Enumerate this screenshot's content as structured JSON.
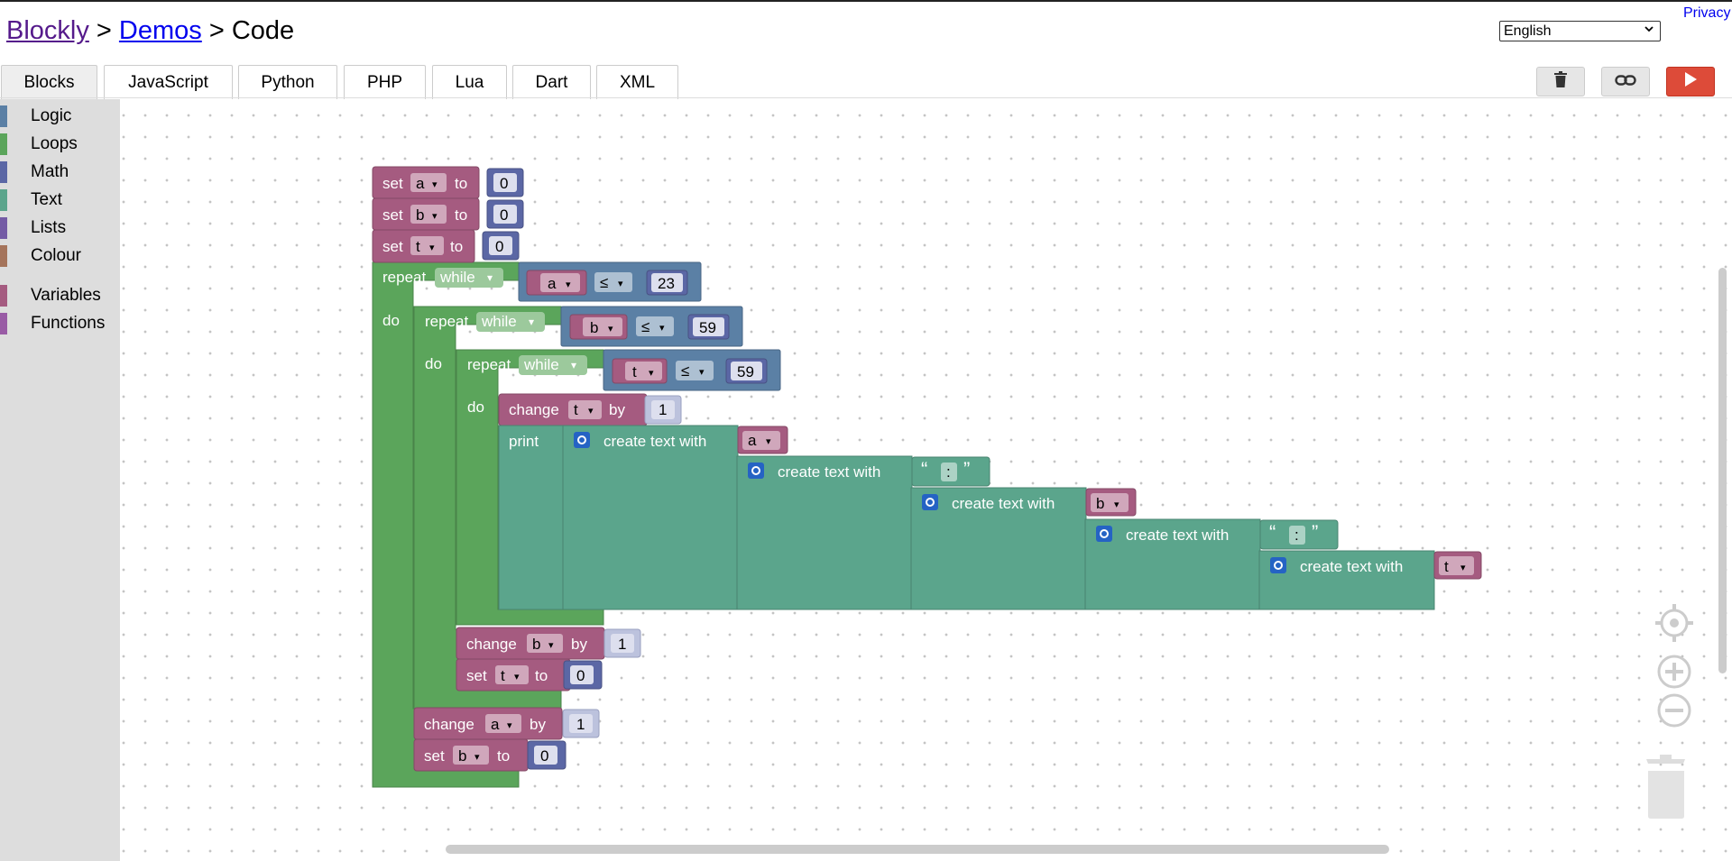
{
  "breadcrumb": {
    "root": "Blockly",
    "sep1": ">",
    "demos": "Demos",
    "sep2": ">",
    "current": "Code"
  },
  "privacy_link": "Privacy",
  "language_select": {
    "selected": "English"
  },
  "tabs": [
    {
      "label": "Blocks",
      "active": true
    },
    {
      "label": "JavaScript",
      "active": false
    },
    {
      "label": "Python",
      "active": false
    },
    {
      "label": "PHP",
      "active": false
    },
    {
      "label": "Lua",
      "active": false
    },
    {
      "label": "Dart",
      "active": false
    },
    {
      "label": "XML",
      "active": false
    }
  ],
  "toolbar_icons": {
    "trash": "trash-icon",
    "link": "link-icon",
    "run": "play-icon"
  },
  "toolbox": {
    "categories": [
      {
        "label": "Logic",
        "color": "#5b80a5"
      },
      {
        "label": "Loops",
        "color": "#5ba55b"
      },
      {
        "label": "Math",
        "color": "#5b67a5"
      },
      {
        "label": "Text",
        "color": "#5ba58c"
      },
      {
        "label": "Lists",
        "color": "#745ba5"
      },
      {
        "label": "Colour",
        "color": "#a5745b"
      },
      {
        "label": "Variables",
        "color": "#a55b80"
      },
      {
        "label": "Functions",
        "color": "#995ba5"
      }
    ]
  },
  "colors": {
    "variables": "#a55b80",
    "loops": "#5ba55b",
    "math": "#5b67a5",
    "logic": "#5b80a5",
    "text": "#5ba58c",
    "run": "#dd4b39"
  },
  "blocks": {
    "set_a": {
      "set": "set",
      "var": "a",
      "to": "to",
      "value": "0"
    },
    "set_b": {
      "set": "set",
      "var": "b",
      "to": "to",
      "value": "0"
    },
    "set_t": {
      "set": "set",
      "var": "t",
      "to": "to",
      "value": "0"
    },
    "loop1": {
      "repeat": "repeat",
      "mode": "while",
      "var": "a",
      "op": "≤",
      "value": "23",
      "do": "do"
    },
    "loop2": {
      "repeat": "repeat",
      "mode": "while",
      "var": "b",
      "op": "≤",
      "value": "59",
      "do": "do"
    },
    "loop3": {
      "repeat": "repeat",
      "mode": "while",
      "var": "t",
      "op": "≤",
      "value": "59",
      "do": "do"
    },
    "change_t": {
      "change": "change",
      "var": "t",
      "by": "by",
      "value": "1"
    },
    "print": {
      "label": "print",
      "create_text_with": "create text with",
      "var_a": "a",
      "colon1": ":",
      "var_b": "b",
      "colon2": ":",
      "var_t": "t",
      "open_quote": "“",
      "close_quote": "”"
    },
    "change_b": {
      "change": "change",
      "var": "b",
      "by": "by",
      "value": "1"
    },
    "set_t_inner": {
      "set": "set",
      "var": "t",
      "to": "to",
      "value": "0"
    },
    "change_a": {
      "change": "change",
      "var": "a",
      "by": "by",
      "value": "1"
    },
    "set_b_inner": {
      "set": "set",
      "var": "b",
      "to": "to",
      "value": "0"
    },
    "dropdown_arrow": "▾"
  }
}
